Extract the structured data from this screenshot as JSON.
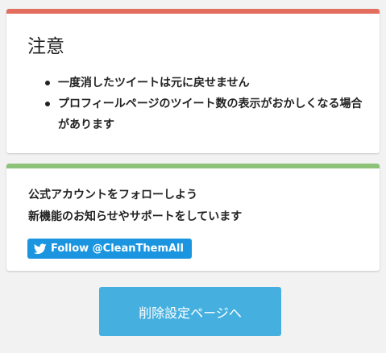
{
  "colors": {
    "background": "#f2f2f2",
    "warning_accent": "#e36e5e",
    "follow_accent": "#8cc378",
    "twitter_blue": "#1b95e0",
    "primary_button": "#45b0e0"
  },
  "warning": {
    "title": "注意",
    "items": [
      "一度消したツイートは元に戻せません",
      "プロフィールページのツイート数の表示がおかしくなる場合があります"
    ]
  },
  "follow": {
    "lines": [
      "公式アカウントをフォローしよう",
      "新機能のお知らせやサポートをしています"
    ],
    "button_icon": "twitter-bird-icon",
    "button_label": "Follow @CleanThemAll"
  },
  "actions": {
    "delete_settings_label": "削除設定ページへ"
  }
}
